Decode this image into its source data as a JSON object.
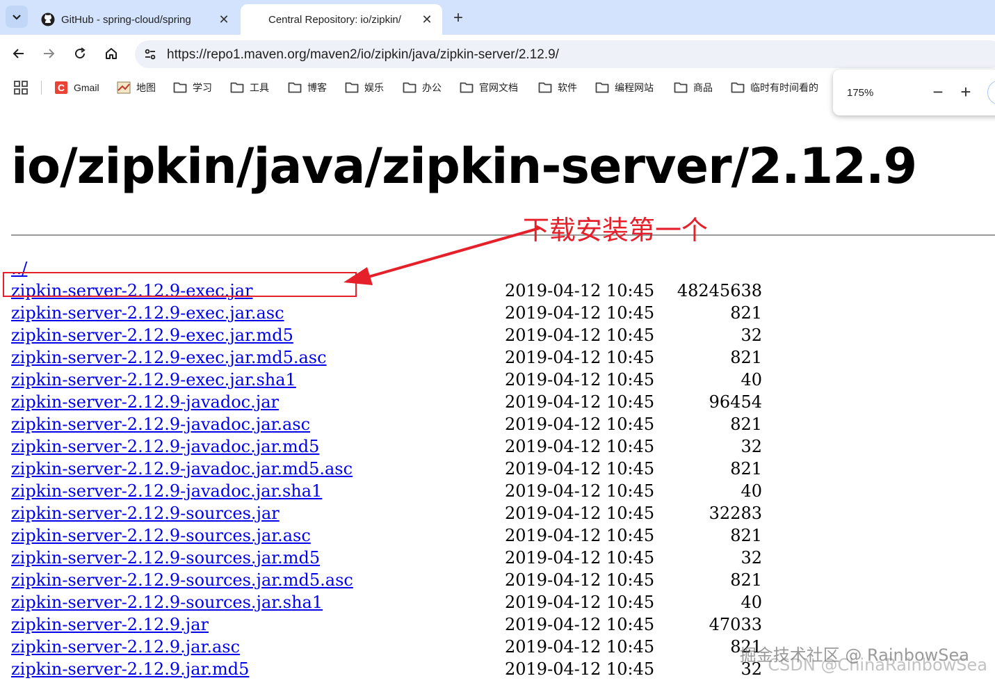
{
  "tabs": [
    {
      "title": "GitHub - spring-cloud/spring",
      "active": false
    },
    {
      "title": "Central Repository: io/zipkin/",
      "active": true
    }
  ],
  "address_bar": {
    "url": "https://repo1.maven.org/maven2/io/zipkin/java/zipkin-server/2.12.9/"
  },
  "bookmarks": [
    {
      "label": "Gmail",
      "icon": "gmail-icon"
    },
    {
      "label": "地图",
      "icon": "map-icon"
    },
    {
      "label": "学习",
      "icon": "folder-icon"
    },
    {
      "label": "工具",
      "icon": "folder-icon"
    },
    {
      "label": "博客",
      "icon": "folder-icon"
    },
    {
      "label": "娱乐",
      "icon": "folder-icon"
    },
    {
      "label": "办公",
      "icon": "folder-icon"
    },
    {
      "label": "官网文档",
      "icon": "folder-icon"
    },
    {
      "label": "软件",
      "icon": "folder-icon"
    },
    {
      "label": "编程网站",
      "icon": "folder-icon"
    },
    {
      "label": "商品",
      "icon": "folder-icon"
    },
    {
      "label": "临时有时间看的",
      "icon": "folder-icon"
    }
  ],
  "zoom": {
    "level": "175%",
    "minus": "−",
    "plus": "+"
  },
  "page": {
    "title": "io/zipkin/java/zipkin-server/2.12.9",
    "parent_link": "../",
    "files": [
      {
        "name": "zipkin-server-2.12.9-exec.jar",
        "date": "2019-04-12 10:45",
        "size": "48245638"
      },
      {
        "name": "zipkin-server-2.12.9-exec.jar.asc",
        "date": "2019-04-12 10:45",
        "size": "821"
      },
      {
        "name": "zipkin-server-2.12.9-exec.jar.md5",
        "date": "2019-04-12 10:45",
        "size": "32"
      },
      {
        "name": "zipkin-server-2.12.9-exec.jar.md5.asc",
        "date": "2019-04-12 10:45",
        "size": "821"
      },
      {
        "name": "zipkin-server-2.12.9-exec.jar.sha1",
        "date": "2019-04-12 10:45",
        "size": "40"
      },
      {
        "name": "zipkin-server-2.12.9-javadoc.jar",
        "date": "2019-04-12 10:45",
        "size": "96454"
      },
      {
        "name": "zipkin-server-2.12.9-javadoc.jar.asc",
        "date": "2019-04-12 10:45",
        "size": "821"
      },
      {
        "name": "zipkin-server-2.12.9-javadoc.jar.md5",
        "date": "2019-04-12 10:45",
        "size": "32"
      },
      {
        "name": "zipkin-server-2.12.9-javadoc.jar.md5.asc",
        "date": "2019-04-12 10:45",
        "size": "821"
      },
      {
        "name": "zipkin-server-2.12.9-javadoc.jar.sha1",
        "date": "2019-04-12 10:45",
        "size": "40"
      },
      {
        "name": "zipkin-server-2.12.9-sources.jar",
        "date": "2019-04-12 10:45",
        "size": "32283"
      },
      {
        "name": "zipkin-server-2.12.9-sources.jar.asc",
        "date": "2019-04-12 10:45",
        "size": "821"
      },
      {
        "name": "zipkin-server-2.12.9-sources.jar.md5",
        "date": "2019-04-12 10:45",
        "size": "32"
      },
      {
        "name": "zipkin-server-2.12.9-sources.jar.md5.asc",
        "date": "2019-04-12 10:45",
        "size": "821"
      },
      {
        "name": "zipkin-server-2.12.9-sources.jar.sha1",
        "date": "2019-04-12 10:45",
        "size": "40"
      },
      {
        "name": "zipkin-server-2.12.9.jar",
        "date": "2019-04-12 10:45",
        "size": "47033"
      },
      {
        "name": "zipkin-server-2.12.9.jar.asc",
        "date": "2019-04-12 10:45",
        "size": "821"
      },
      {
        "name": "zipkin-server-2.12.9.jar.md5",
        "date": "2019-04-12 10:45",
        "size": "32"
      }
    ]
  },
  "annotation": {
    "text": "下载安装第一个",
    "color": "#e5202a"
  },
  "watermark": {
    "line1": "掘金技术社区 @ RainbowSea",
    "line2": "CSDN @ChinaRainbowSea"
  }
}
